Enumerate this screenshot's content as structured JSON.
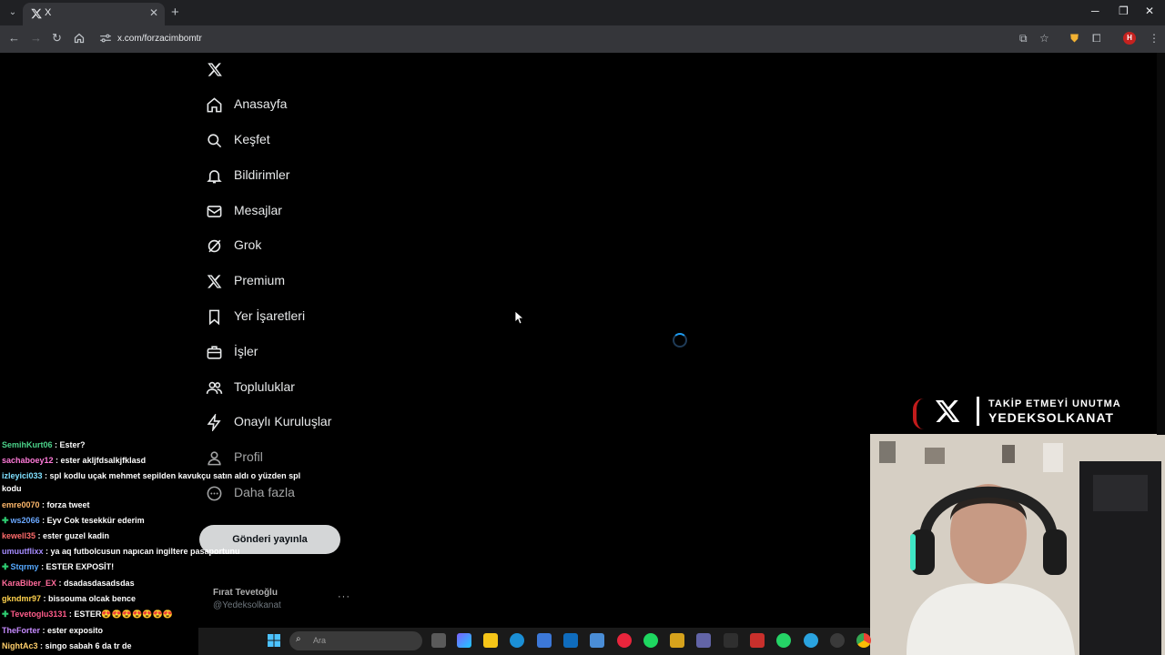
{
  "browser": {
    "tab_title": "X",
    "tab_favicon": "x-logo-icon",
    "url": "x.com/forzacimbomtr",
    "profile_initial": "H"
  },
  "sidebar": {
    "items": [
      {
        "label": "Anasayfa",
        "icon": "home-icon"
      },
      {
        "label": "Keşfet",
        "icon": "search-icon"
      },
      {
        "label": "Bildirimler",
        "icon": "bell-icon"
      },
      {
        "label": "Mesajlar",
        "icon": "mail-icon"
      },
      {
        "label": "Grok",
        "icon": "grok-icon"
      },
      {
        "label": "Premium",
        "icon": "x-logo-icon"
      },
      {
        "label": "Yer İşaretleri",
        "icon": "bookmark-icon"
      },
      {
        "label": "İşler",
        "icon": "briefcase-icon"
      },
      {
        "label": "Topluluklar",
        "icon": "people-icon"
      },
      {
        "label": "Onaylı Kuruluşlar",
        "icon": "lightning-icon"
      },
      {
        "label": "Profil",
        "icon": "person-icon"
      },
      {
        "label": "Daha fazla",
        "icon": "more-circle-icon"
      }
    ],
    "post_button": "Gönderi yayınla",
    "account_name": "Fırat Tevetoğlu",
    "account_handle": "@Yedeksolkanat",
    "more_label": "···"
  },
  "chat": {
    "messages": [
      {
        "user": "SemihKurt06",
        "color": "#4bd38a",
        "text": " : Ester?",
        "badge": false
      },
      {
        "user": "sachaboey12",
        "color": "#ff7ad9",
        "text": " : ester akljfdsalkjfklasd",
        "badge": false
      },
      {
        "user": "izleyici033",
        "color": "#7fe0ff",
        "text": " : spl kodlu uçak mehmet sepilden kavukçu satın aldı o yüzden spl kodu",
        "badge": false
      },
      {
        "user": "emre0070",
        "color": "#ffb86b",
        "text": " : forza tweet",
        "badge": false
      },
      {
        "user": "ws2066",
        "color": "#6aa8ff",
        "text": " : Eyv Cok tesekkür ederim",
        "badge": true
      },
      {
        "user": "kewell35",
        "color": "#ff6b6b",
        "text": " : ester guzel kadin",
        "badge": false
      },
      {
        "user": "umuutflixx",
        "color": "#a58bff",
        "text": " : ya aq futbolcusun napıcan ingiltere pasaportunu",
        "badge": false
      },
      {
        "user": "Stqrmy",
        "color": "#55a8ff",
        "text": " : ESTER EXPOSİT!",
        "badge": true
      },
      {
        "user": "KaraBiber_EX",
        "color": "#ff6b9b",
        "text": " : dsadasdasadsdas",
        "badge": false
      },
      {
        "user": "gkndmr97",
        "color": "#ffd24d",
        "text": " : bissouma olcak bence",
        "badge": false
      },
      {
        "user": "Tevetoglu3131",
        "color": "#ff5c8a",
        "text": " : ESTER😍😍😍😍😍😍😍",
        "badge": true
      },
      {
        "user": "TheForter",
        "color": "#c68bff",
        "text": " : ester exposito",
        "badge": false
      },
      {
        "user": "NightAc3",
        "color": "#ffcf6b",
        "text": " : singo sabah 6 da tr de",
        "badge": false
      }
    ]
  },
  "brand": {
    "line1": "TAKİP ETMEYİ UNUTMA",
    "line2": "YEDEKSOLKANAT"
  },
  "taskbar": {
    "search_placeholder": "Ara"
  }
}
